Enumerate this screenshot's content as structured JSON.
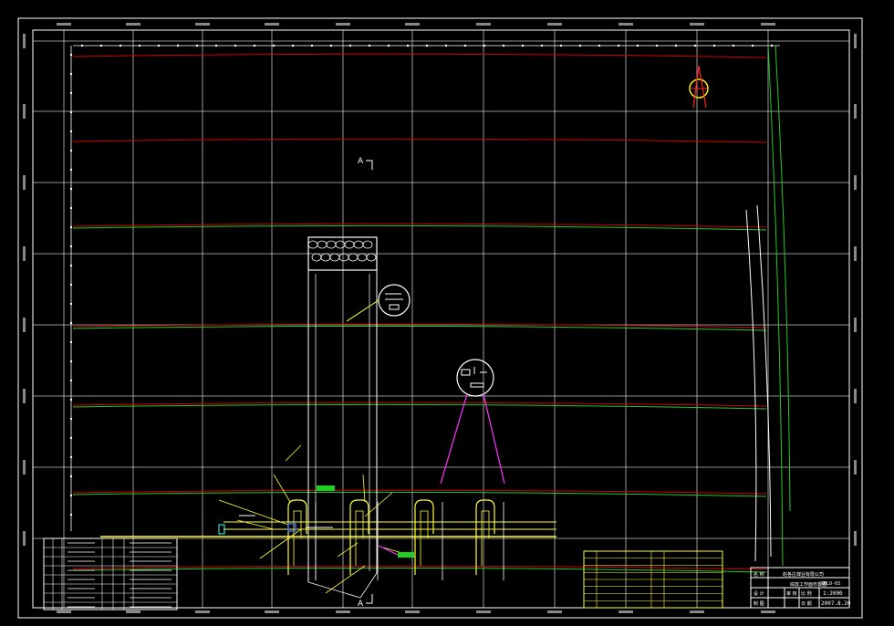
{
  "drawing": {
    "section_mark_top": "A",
    "section_mark_bottom": "A",
    "title_block": {
      "row1_left": "名  称",
      "row1_right": "赵各庄煤业有限公司",
      "row2_right": "综放工作面布置图",
      "row3_a": "设  计",
      "row3_b": "审  核",
      "row3_c": "比  例",
      "scale": "1:2000",
      "row4_a": "制  图",
      "row4_c": "日  期",
      "date": "2007.8.20",
      "number_label": "XMLO-03"
    }
  },
  "colors": {
    "grid": "#ffffff",
    "red_contour": "#d40000",
    "green_contour": "#22cc22",
    "yellow": "#ffff33",
    "magenta": "#ff33ff",
    "cyan": "#33ffff"
  }
}
